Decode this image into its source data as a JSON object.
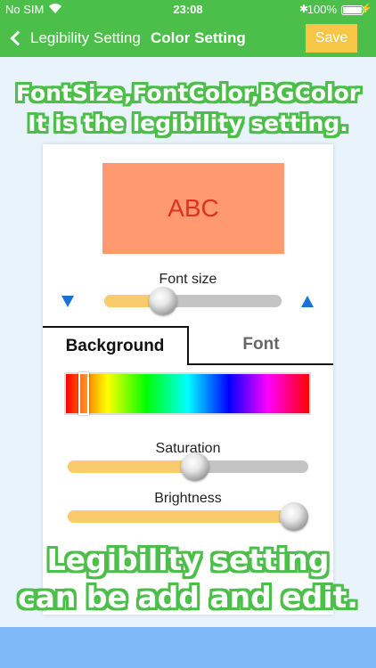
{
  "status": {
    "carrier": "No SIM",
    "time": "23:08",
    "battery": "100%"
  },
  "nav": {
    "back_label": "Legibility Setting",
    "title": "Color Setting",
    "save_label": "Save"
  },
  "captions": {
    "top_line1": "FontSize,FontColor,BGColor",
    "top_line2": "It is the legibility setting.",
    "bottom_line1": "Legibility setting",
    "bottom_line2": "can be add and edit."
  },
  "preview": {
    "text": "ABC",
    "background": "#ff9a70",
    "text_color": "#e03024"
  },
  "font_size": {
    "label": "Font size",
    "level": 0.33
  },
  "tabs": {
    "background": "Background",
    "font": "Font",
    "selected": "Background"
  },
  "hue": {
    "position": 0.06
  },
  "saturation": {
    "label": "Saturation",
    "level": 0.53
  },
  "brightness": {
    "label": "Brightness",
    "level": 0.95
  },
  "colors": {
    "accent_green": "#4cbf4a",
    "save_button": "#f7c645",
    "slider_fill": "#f9cb6c",
    "arrow_blue": "#1a72d8",
    "bottom_band": "#7fb8f7"
  }
}
